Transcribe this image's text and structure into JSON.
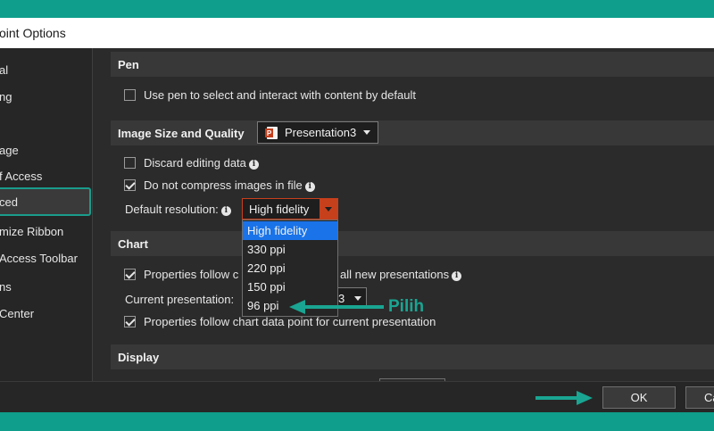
{
  "window": {
    "title": "oint Options"
  },
  "sidebar": {
    "items": [
      {
        "label": "al"
      },
      {
        "label": "ng"
      },
      {
        "label": ""
      },
      {
        "label": "age"
      },
      {
        "label": "f Access"
      },
      {
        "label": "ced"
      },
      {
        "label": "mize Ribbon"
      },
      {
        "label": "Access Toolbar"
      },
      {
        "label": "ns"
      },
      {
        "label": "Center"
      }
    ]
  },
  "pen": {
    "header": "Pen",
    "use_pen_label": "Use pen to select and interact with content by default",
    "use_pen_checked": false
  },
  "image_quality": {
    "header": "Image Size and Quality",
    "presentation": "Presentation3",
    "discard_label": "Discard editing data",
    "discard_checked": false,
    "no_compress_label": "Do not compress images in file",
    "no_compress_checked": true,
    "resolution_label": "Default resolution:",
    "resolution_value": "High fidelity",
    "resolution_options": [
      "High fidelity",
      "330 ppi",
      "220 ppi",
      "150 ppi",
      "96 ppi"
    ]
  },
  "chart": {
    "header": "Chart",
    "follow_all_prefix": "Properties follow c",
    "follow_all_suffix": "all new presentations",
    "follow_all_checked": true,
    "current_label": "Current presentation:",
    "current_value_partial": "3",
    "follow_current_label": "Properties follow chart data point for current presentation",
    "follow_current_checked": true
  },
  "display": {
    "header": "Display"
  },
  "annotation": {
    "text": "Pilih"
  },
  "footer": {
    "ok_label": "OK",
    "cancel_label": "Ca"
  },
  "colors": {
    "accent": "#19a592",
    "selection": "#1a73e8",
    "dropdown_button": "#c7401c"
  }
}
